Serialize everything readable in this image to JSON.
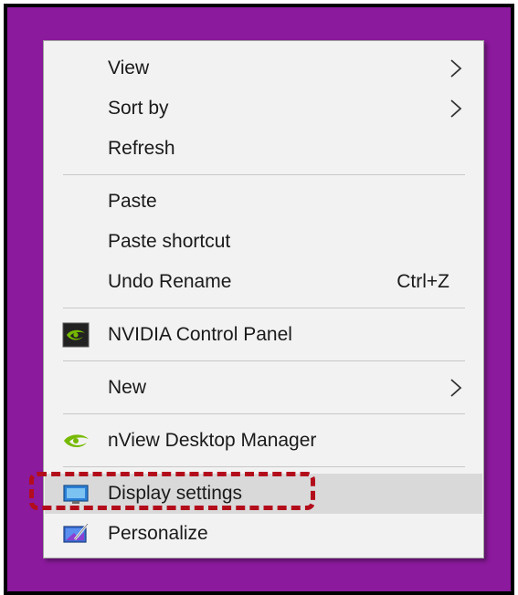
{
  "colors": {
    "background": "#8b1a9c",
    "menu_bg": "#f2f2f2",
    "highlight": "#d9d9d9",
    "callout": "#b30d1c",
    "nvidia_green": "#76b900"
  },
  "menu": {
    "view": {
      "label": "View",
      "icon": "chevron-right-icon"
    },
    "sort_by": {
      "label": "Sort by",
      "icon": "chevron-right-icon"
    },
    "refresh": {
      "label": "Refresh"
    },
    "paste": {
      "label": "Paste"
    },
    "paste_shortcut": {
      "label": "Paste shortcut"
    },
    "undo_rename": {
      "label": "Undo Rename",
      "shortcut": "Ctrl+Z"
    },
    "nvidia_control_panel": {
      "label": "NVIDIA Control Panel",
      "icon": "nvidia-icon"
    },
    "new": {
      "label": "New",
      "icon": "chevron-right-icon"
    },
    "nview_desktop_manager": {
      "label": "nView Desktop Manager",
      "icon": "nvidia-eye-icon"
    },
    "display_settings": {
      "label": "Display settings",
      "icon": "display-icon",
      "highlighted": true
    },
    "personalize": {
      "label": "Personalize",
      "icon": "personalize-icon"
    }
  }
}
